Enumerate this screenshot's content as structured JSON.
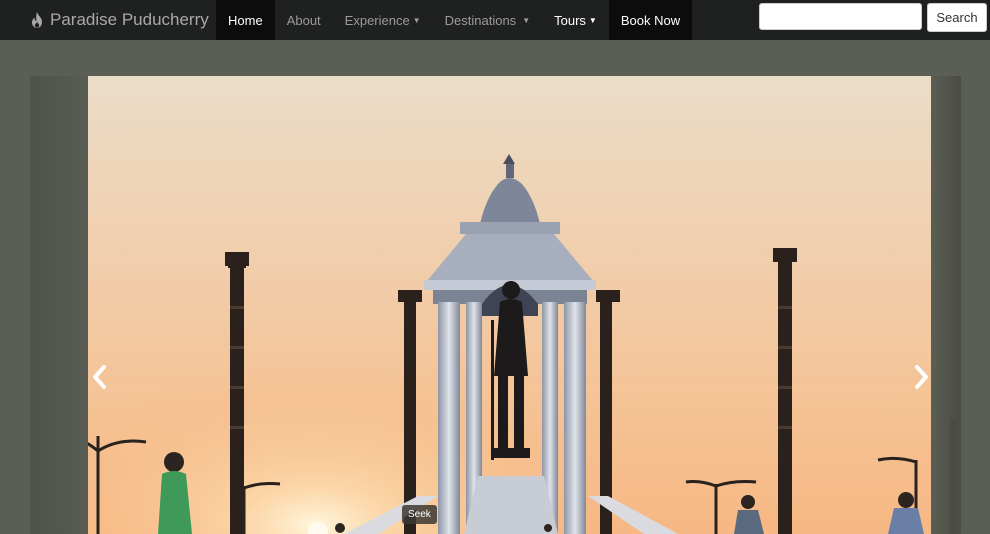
{
  "brand": {
    "name": "Paradise Puducherry",
    "icon": "flame-icon"
  },
  "nav": {
    "home": "Home",
    "about": "About",
    "experience": "Experience",
    "destinations": "Destinations",
    "tours": "Tours",
    "book": "Book Now"
  },
  "search": {
    "placeholder": "",
    "value": "",
    "button": "Search"
  },
  "carousel": {
    "prev_icon": "chevron-left-icon",
    "next_icon": "chevron-right-icon",
    "seek_tooltip": "Seek"
  },
  "colors": {
    "navbar_bg": "#1f2120",
    "active_bg": "#0b0c0b",
    "page_bg": "#5a5e55",
    "sky_top": "#eddcc6",
    "sky_mid": "#f4c59a",
    "sun": "#fff4d8"
  }
}
